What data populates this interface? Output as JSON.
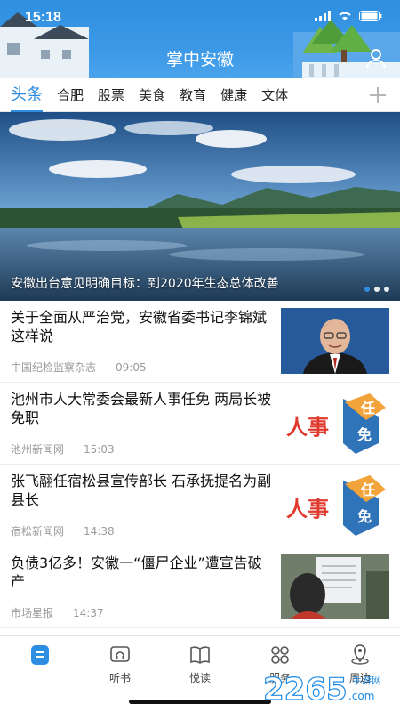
{
  "status": {
    "time": "15:18"
  },
  "header": {
    "title": "掌中安徽"
  },
  "tabs": [
    "头条",
    "合肥",
    "股票",
    "美食",
    "教育",
    "健康",
    "文体"
  ],
  "hero": {
    "caption": "安徽出台意见明确目标：到2020年生态总体改善"
  },
  "news": [
    {
      "title": "关于全面从严治党，安徽省委书记李锦斌这样说",
      "source": "中国纪检监察杂志",
      "time": "09:05"
    },
    {
      "title": "池州市人大常委会最新人事任免 两局长被免职",
      "source": "池州新闻网",
      "time": "15:03",
      "thumb_text": "人事任免"
    },
    {
      "title": "张飞翮任宿松县宣传部长 石承抚提名为副县长",
      "source": "宿松新闻网",
      "time": "14:38",
      "thumb_text": "人事任免"
    },
    {
      "title": "负债3亿多！安徽一“僵尸企业”遭宣告破产",
      "source": "市场星报",
      "time": "14:37"
    }
  ],
  "bottom_nav": [
    "听书",
    "悦读",
    "服务",
    "周边"
  ],
  "watermark": {
    "text": "2265",
    "sub": "手游网",
    "dot_com": ".com"
  },
  "colors": {
    "accent": "#2d8de0",
    "header": "#3b98e6"
  }
}
